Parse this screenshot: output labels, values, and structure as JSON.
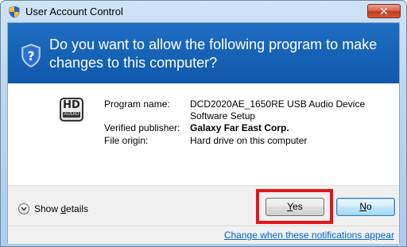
{
  "window": {
    "title": "User Account Control",
    "close_label": "✕"
  },
  "banner": {
    "question": "Do you want to allow the following program to make changes to this computer?"
  },
  "program": {
    "logo_text": "HD",
    "logo_sub": "AUDIO",
    "name_label": "Program name:",
    "name_value_line1": "DCD2020AE_1650RE USB Audio Device",
    "name_value_line2": "Software Setup",
    "publisher_label": "Verified publisher:",
    "publisher_value": "Galaxy Far East Corp.",
    "origin_label": "File origin:",
    "origin_value": "Hard drive on this computer"
  },
  "footer": {
    "show_details_prefix": "Show ",
    "show_details_accel": "d",
    "show_details_suffix": "etails",
    "yes_accel": "Y",
    "yes_rest": "es",
    "no_accel": "N",
    "no_rest": "o",
    "notifications_link": "Change when these notifications appear"
  },
  "colors": {
    "banner": "#1561b4",
    "highlight": "#e2161a",
    "link": "#0066cc"
  }
}
